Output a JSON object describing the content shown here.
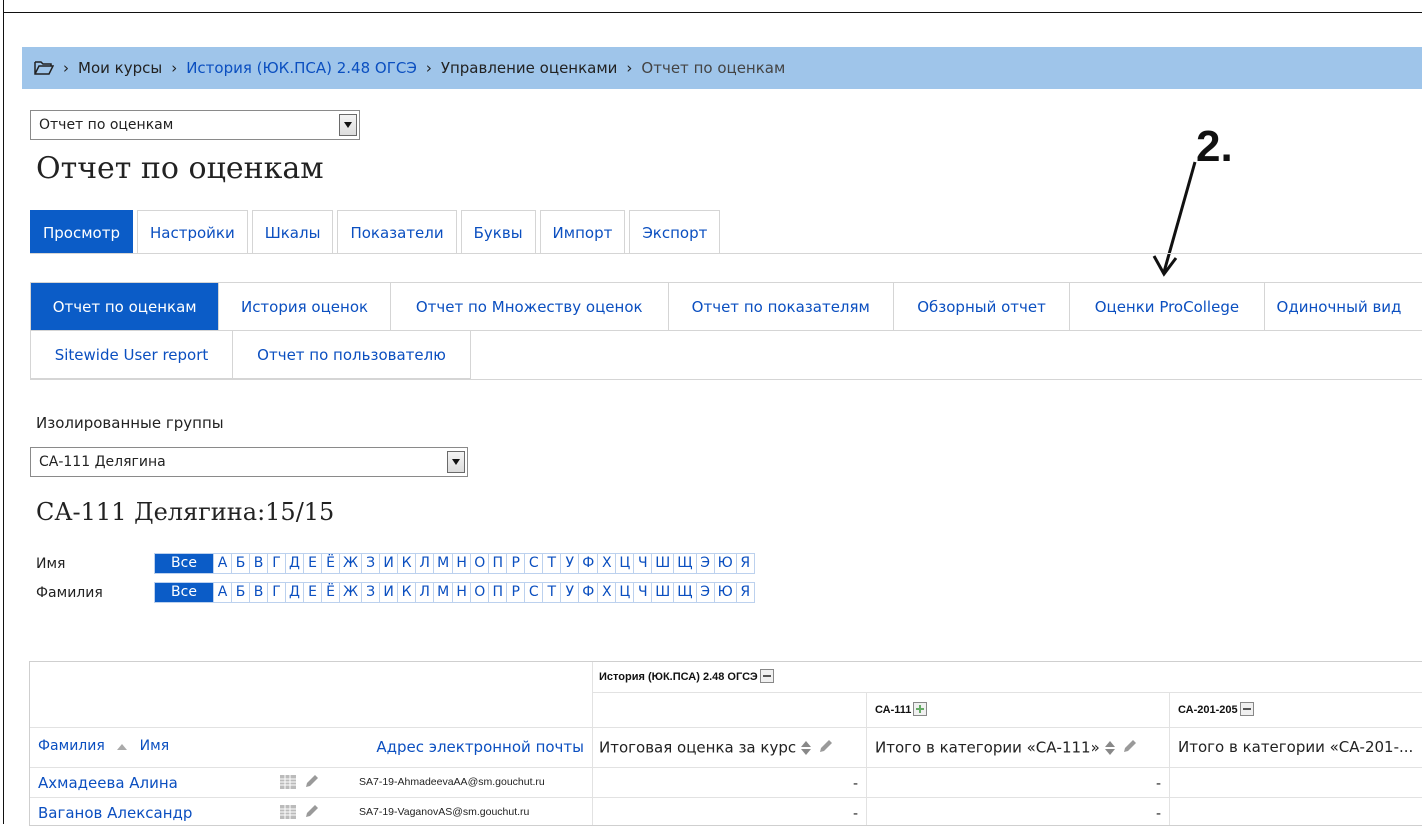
{
  "breadcrumb": {
    "items": [
      "Мои курсы",
      "История (ЮК.ПСА) 2.48 ОГСЭ",
      "Управление оценками",
      "Отчет по оценкам"
    ],
    "separator": "›"
  },
  "report_select": {
    "value": "Отчет по оценкам"
  },
  "page_title": "Отчет по оценкам",
  "main_tabs": [
    "Просмотр",
    "Настройки",
    "Шкалы",
    "Показатели",
    "Буквы",
    "Импорт",
    "Экспорт"
  ],
  "sub_tabs_row1": [
    "Отчет по оценкам",
    "История оценок",
    "Отчет по Множеству оценок",
    "Отчет по показателям",
    "Обзорный отчет",
    "Оценки ProCollege",
    "Одиночный вид"
  ],
  "sub_tabs_row2": [
    "Sitewide User report",
    "Отчет по пользователю"
  ],
  "annotation": {
    "label": "2."
  },
  "groups": {
    "label": "Изолированные группы",
    "selected": "СА-111 Делягина",
    "title": "СА-111 Делягина:15/15"
  },
  "initials": {
    "first_label": "Имя",
    "last_label": "Фамилия",
    "all_label": "Все",
    "letters": [
      "А",
      "Б",
      "В",
      "Г",
      "Д",
      "Е",
      "Ё",
      "Ж",
      "З",
      "И",
      "К",
      "Л",
      "М",
      "Н",
      "О",
      "П",
      "Р",
      "С",
      "Т",
      "У",
      "Ф",
      "Х",
      "Ц",
      "Ч",
      "Ш",
      "Щ",
      "Э",
      "Ю",
      "Я"
    ]
  },
  "grader": {
    "course_header": "История (ЮК.ПСА) 2.48 ОГСЭ",
    "cat1": "СА-111",
    "cat2": "СА-201-205",
    "col_lastname": "Фамилия",
    "col_firstname": "Имя",
    "col_email": "Адрес электронной почты",
    "col_course_total": "Итоговая оценка за курс",
    "col_cat1_total": "Итого в категории «СА-111»",
    "col_cat2_total": "Итого в категории «СА-201-...",
    "rows": [
      {
        "name": "Ахмадеева Алина",
        "email": "SA7-19-AhmadeevaAA@sm.gouchut.ru",
        "v1": "-",
        "v2": "-"
      },
      {
        "name": "Ваганов Александр",
        "email": "SA7-19-VaganovAS@sm.gouchut.ru",
        "v1": "-",
        "v2": "-"
      }
    ]
  }
}
